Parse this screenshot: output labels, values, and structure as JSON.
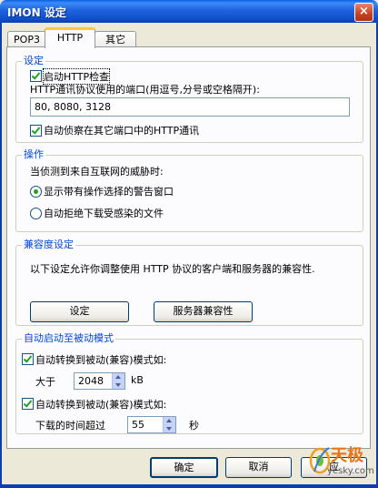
{
  "window": {
    "title": "IMON 设定",
    "close_symbol": "×"
  },
  "tabs": [
    {
      "label": "POP3"
    },
    {
      "label": "HTTP"
    },
    {
      "label": "其它"
    }
  ],
  "settings_group": {
    "title": "设定",
    "enable_http_check": {
      "label": "启动HTTP检查",
      "checked": true
    },
    "ports_label": "HTTP通讯协议使用的端口(用逗号,分号或空格隔开):",
    "ports_value": "80, 8080, 3128",
    "auto_detect": {
      "label": "自动侦察在其它端口中的HTTP通讯",
      "checked": true
    }
  },
  "action_group": {
    "title": "操作",
    "prompt": "当侦测到来自互联网的威胁时:",
    "option_warn": {
      "label": "显示带有操作选择的警告窗口",
      "selected": true
    },
    "option_reject": {
      "label": "自动拒绝下载受感染的文件",
      "selected": false
    }
  },
  "compat_group": {
    "title": "兼容度设定",
    "description": "以下设定允许你调整使用 HTTP 协议的客户端和服务器的兼容性.",
    "settings_button": "设定",
    "server_compat_button": "服务器兼容性"
  },
  "passive_group": {
    "title": "自动启动至被动模式",
    "size_mode": {
      "label": "自动转换到被动(兼容)模式如:",
      "checked": true,
      "prefix": "大于",
      "value": "2048",
      "unit": "kB"
    },
    "time_mode": {
      "label": "自动转换到被动(兼容)模式如:",
      "checked": true,
      "prefix": "下载的时间超过",
      "value": "55",
      "unit": "秒"
    }
  },
  "footer": {
    "ok": "确定",
    "cancel": "取消",
    "apply": "应"
  },
  "watermark": {
    "brand": "天极",
    "site": "yesky.com"
  }
}
